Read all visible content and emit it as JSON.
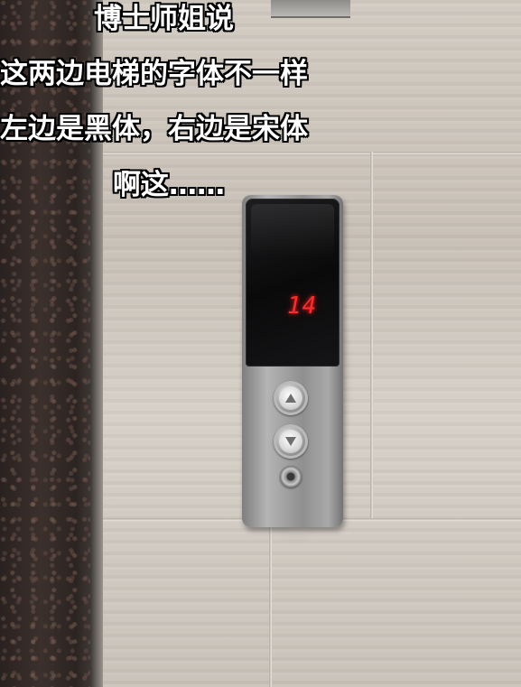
{
  "caption": {
    "line1": "博士师姐说",
    "line2": "这两边电梯的字体不一样",
    "line3": "左边是黑体，右边是宋体",
    "line4": "啊这……"
  },
  "elevator_panel": {
    "floor_display": "14",
    "display_color": "#ff2a2a",
    "buttons": [
      "up-arrow-icon",
      "down-arrow-icon"
    ],
    "key_switch": "keyhole-icon"
  }
}
